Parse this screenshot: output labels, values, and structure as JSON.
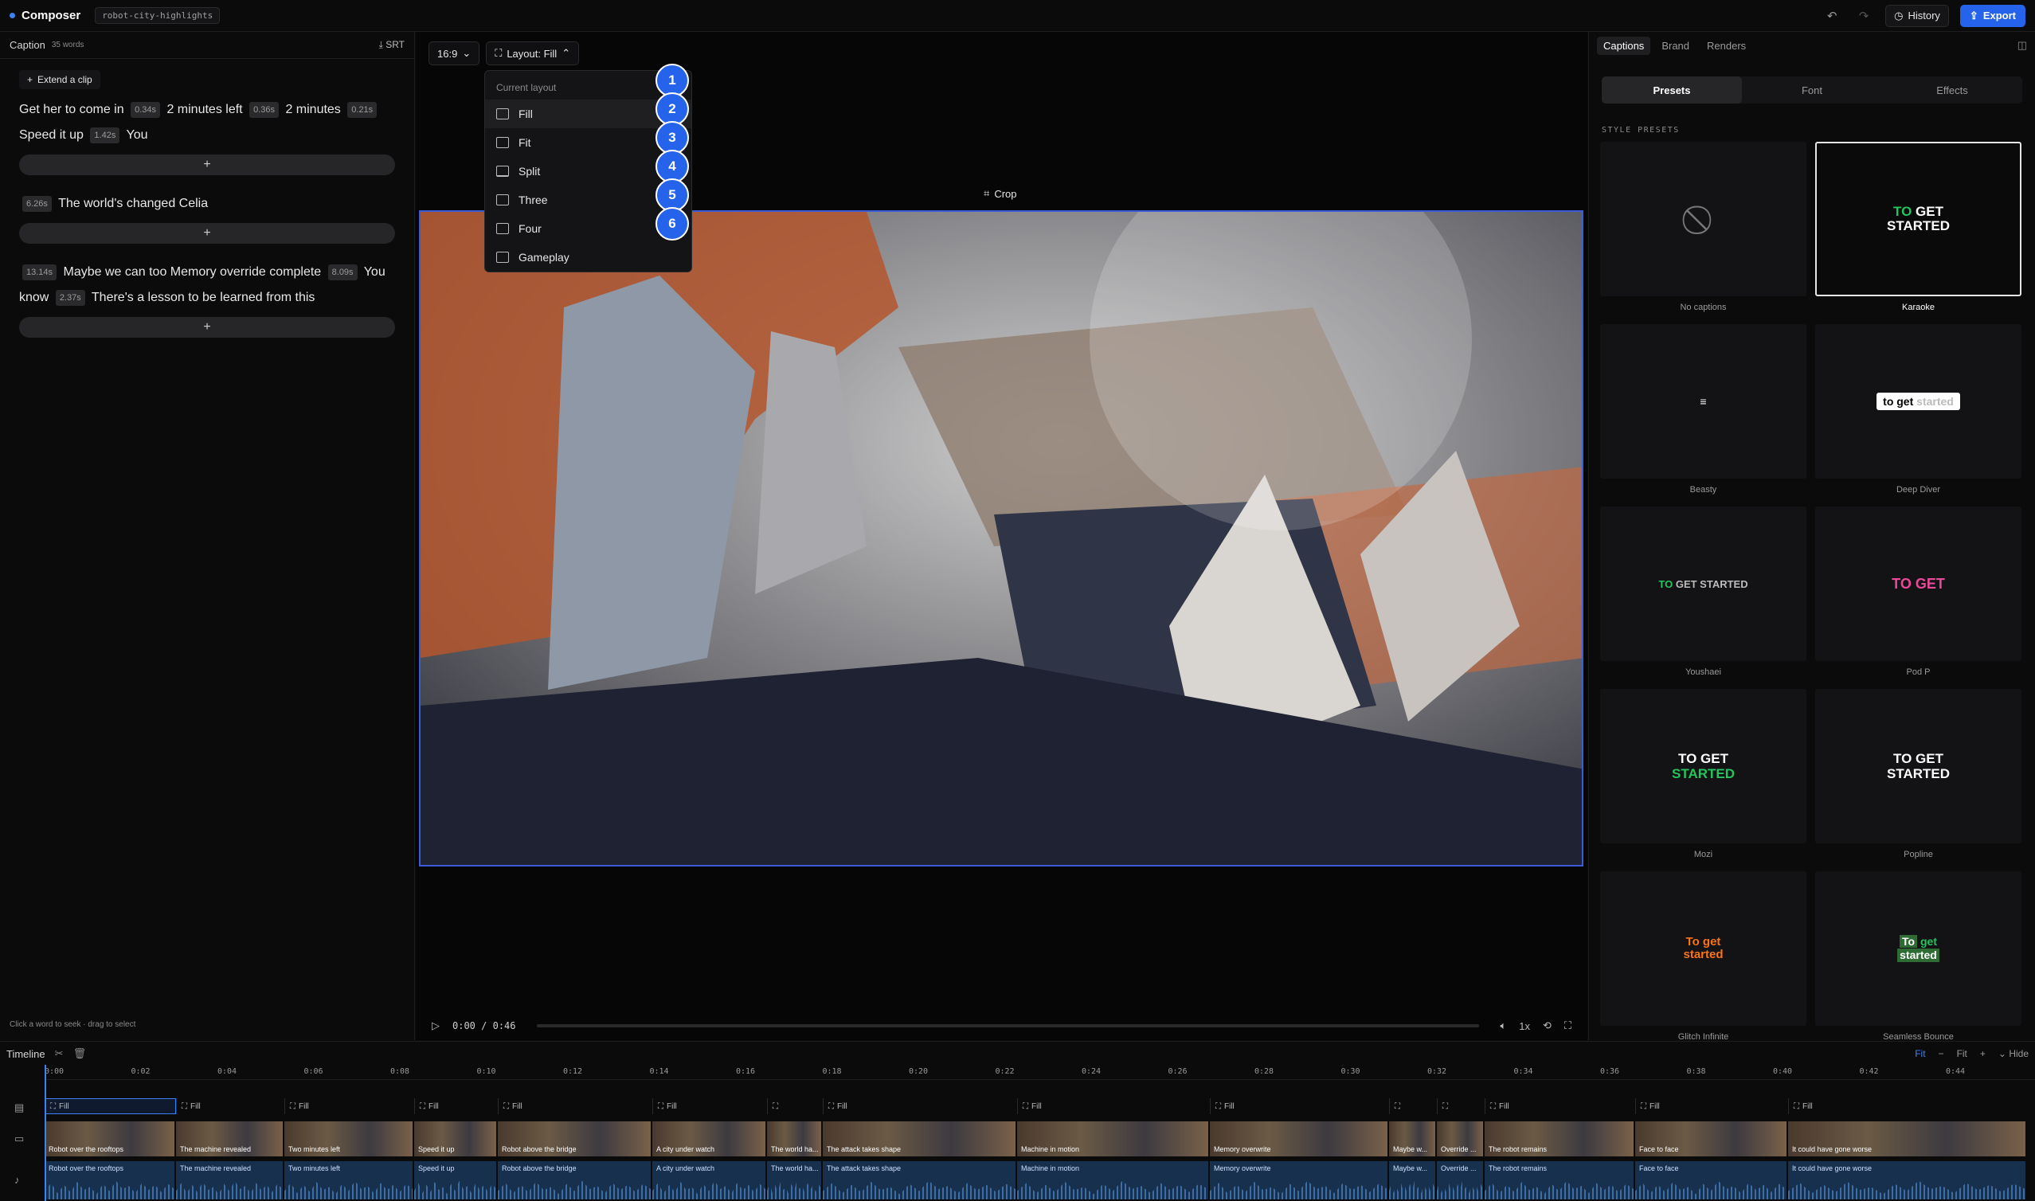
{
  "app": {
    "name": "Composer",
    "project": "robot-city-highlights"
  },
  "top": {
    "history_label": "History",
    "export_label": "Export"
  },
  "left": {
    "title": "Caption",
    "word_count": "35 words",
    "srt_label": "SRT",
    "extend_label": "Extend a clip",
    "footer": "Click a word to seek · drag to select",
    "blocks": [
      {
        "parts": [
          {
            "t": "Get her to come in"
          },
          {
            "g": "0.34s"
          },
          {
            "t": "2 minutes left"
          },
          {
            "g": "0.36s"
          },
          {
            "t": "2 minutes"
          },
          {
            "g": "0.21s"
          },
          {
            "t": "Speed it up"
          },
          {
            "g": "1.42s"
          },
          {
            "t": "You"
          }
        ]
      },
      {
        "parts": [
          {
            "g": "6.26s"
          },
          {
            "t": "The world's changed Celia"
          }
        ]
      },
      {
        "parts": [
          {
            "g": "13.14s"
          },
          {
            "t": "Maybe we can too Memory override complete"
          },
          {
            "g": "8.09s"
          },
          {
            "t": "You know"
          },
          {
            "g": "2.37s"
          },
          {
            "t": "There's a lesson to be learned from this"
          }
        ]
      }
    ]
  },
  "center": {
    "ratio_label": "16:9",
    "layout_label": "Layout: Fill",
    "crop_label": "Crop",
    "time_current": "0:00",
    "time_total": "0:46",
    "speed": "1x"
  },
  "dropdown": {
    "heading": "Current layout",
    "items": [
      "Fill",
      "Fit",
      "Split",
      "Three",
      "Four",
      "Gameplay"
    ],
    "badges": [
      "1",
      "2",
      "3",
      "4",
      "5",
      "6"
    ]
  },
  "right": {
    "tabs": [
      "Captions",
      "Brand",
      "Renders"
    ],
    "segments": [
      "Presets",
      "Font",
      "Effects"
    ],
    "section_title": "STYLE PRESETS",
    "presets": [
      "No captions",
      "Karaoke",
      "Beasty",
      "Deep Diver",
      "Youshaei",
      "Pod P",
      "Mozi",
      "Popline",
      "Glitch Infinite",
      "Seamless Bounce"
    ],
    "sample_text": {
      "karaoke_a": "TO",
      "karaoke_b": "GET STARTED",
      "deep_a": "to get",
      "deep_b": "started",
      "you_a": "TO",
      "you_b": "GET STARTED",
      "pod": "TO GET",
      "mozi_a": "TO GET",
      "mozi_b": "STARTED",
      "pop_a": "TO GET",
      "pop_b": "STARTED",
      "glitch_a": "To get",
      "glitch_b": "started",
      "bounce_a": "To",
      "bounce_b": "get",
      "bounce_c": "started"
    }
  },
  "timeline": {
    "title": "Timeline",
    "fit_blue": "Fit",
    "fit_label": "Fit",
    "hide_label": "Hide",
    "ticks": [
      "0:00",
      "0:02",
      "0:04",
      "0:06",
      "0:08",
      "0:10",
      "0:12",
      "0:14",
      "0:16",
      "0:18",
      "0:20",
      "0:22",
      "0:24",
      "0:26",
      "0:28",
      "0:30",
      "0:32",
      "0:34",
      "0:36",
      "0:38",
      "0:40",
      "0:42",
      "0:44"
    ],
    "layout_tag": "Fill",
    "clips": [
      "Robot over the rooftops",
      "The machine revealed",
      "Two minutes left",
      "Speed it up",
      "Robot above the bridge",
      "A city under watch",
      "The world ha...",
      "The attack takes shape",
      "Machine in motion",
      "Memory overwrite",
      "Maybe w...",
      "Override ...",
      "The robot remains",
      "Face to face",
      "It could have gone worse"
    ]
  },
  "colors": {
    "accent": "#2563eb",
    "selection": "#3b5bdb"
  }
}
